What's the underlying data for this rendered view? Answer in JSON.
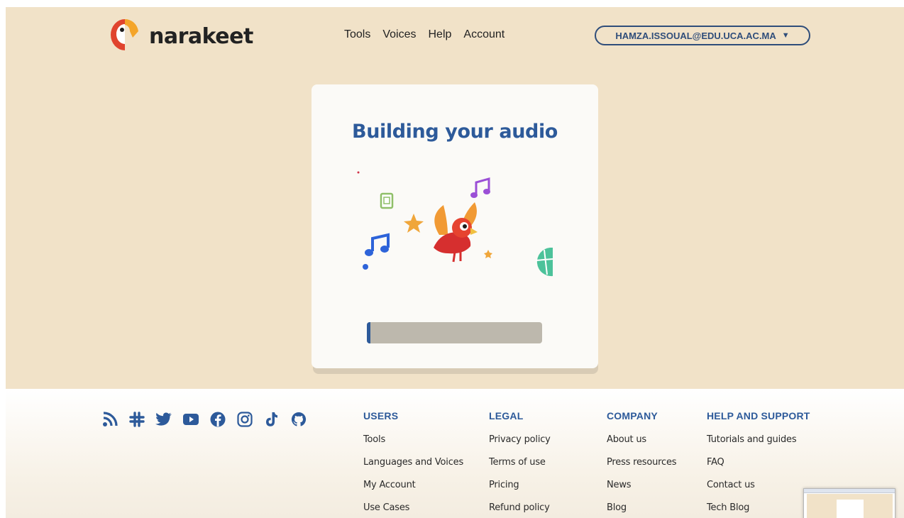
{
  "header": {
    "logo_text": "narakeet",
    "nav": [
      "Tools",
      "Voices",
      "Help",
      "Account"
    ],
    "account_email": "HAMZA.ISSOUAL@EDU.UCA.AC.MA",
    "account_caret": "▼"
  },
  "card": {
    "title": "Building your audio",
    "progress": 0.01
  },
  "footer": {
    "socials": [
      "rss-icon",
      "slack-icon",
      "twitter-icon",
      "youtube-icon",
      "facebook-icon",
      "instagram-icon",
      "tiktok-icon",
      "github-icon"
    ],
    "columns": [
      {
        "heading": "USERS",
        "links": [
          "Tools",
          "Languages and Voices",
          "My Account",
          "Use Cases"
        ]
      },
      {
        "heading": "LEGAL",
        "links": [
          "Privacy policy",
          "Terms of use",
          "Pricing",
          "Refund policy"
        ]
      },
      {
        "heading": "COMPANY",
        "links": [
          "About us",
          "Press resources",
          "News",
          "Blog"
        ]
      },
      {
        "heading": "HELP AND SUPPORT",
        "links": [
          "Tutorials and guides",
          "FAQ",
          "Contact us",
          "Tech Blog"
        ]
      }
    ]
  },
  "colors": {
    "background": "#f1e2c8",
    "brand_blue": "#2d5a9a",
    "progress_track": "#bdb8ad"
  }
}
